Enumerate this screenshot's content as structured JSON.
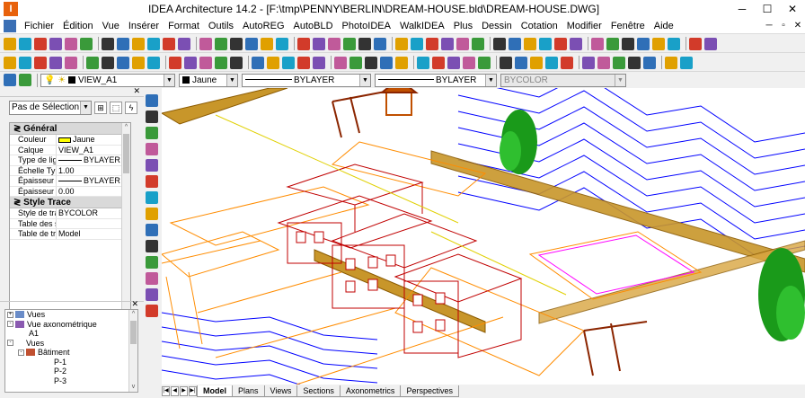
{
  "window": {
    "title": "IDEA Architecture 14.2  - [F:\\tmp\\PENNY\\BERLIN\\DREAM-HOUSE.bld\\DREAM-HOUSE.DWG]",
    "app_icon": "IDEA-app-icon",
    "controls": [
      "─",
      "☐",
      "✕"
    ]
  },
  "menu": [
    "Fichier",
    "Édition",
    "Vue",
    "Insérer",
    "Format",
    "Outils",
    "AutoREG",
    "AutoBLD",
    "PhotoIDEA",
    "WalkIDEA",
    "Plus",
    "Dessin",
    "Cotation",
    "Modifier",
    "Fenêtre",
    "Aide"
  ],
  "menu_right_controls": [
    "─",
    "▫",
    "✕"
  ],
  "layer_bar": {
    "layer": "VIEW_A1",
    "color": "Jaune",
    "linetype": "BYLAYER",
    "lineweight": "BYLAYER",
    "plotstyle": "BYCOLOR"
  },
  "properties": {
    "selection": "Pas de Sélection",
    "sections": [
      {
        "title": "Général",
        "rows": [
          {
            "name": "Couleur",
            "value": "Jaune"
          },
          {
            "name": "Calque",
            "value": "VIEW_A1"
          },
          {
            "name": "Type de ligne",
            "value": "BYLAYER"
          },
          {
            "name": "Échelle Typ...",
            "value": "1.00"
          },
          {
            "name": "Épaisseur ligne",
            "value": "BYLAYER"
          },
          {
            "name": "Épaisseur",
            "value": "0.00"
          }
        ]
      },
      {
        "title": "Style Trace",
        "rows": [
          {
            "name": "Style de trace",
            "value": "BYCOLOR"
          },
          {
            "name": "Table des st...",
            "value": ""
          },
          {
            "name": "Table de tra...",
            "value": "Model"
          }
        ]
      }
    ]
  },
  "tree": [
    {
      "label": "Vues",
      "level": 0,
      "toggle": "+",
      "icon": true
    },
    {
      "label": "Vue axonométrique",
      "level": 0,
      "toggle": "-",
      "icon": true
    },
    {
      "label": "A1",
      "level": 1,
      "toggle": "",
      "icon": false
    },
    {
      "label": "Vues",
      "level": 0,
      "toggle": "-",
      "icon": false
    },
    {
      "label": "Bâtiment",
      "level": 1,
      "toggle": "-",
      "icon": true
    },
    {
      "label": "P-1",
      "level": 2,
      "toggle": "",
      "icon": false
    },
    {
      "label": "P-2",
      "level": 2,
      "toggle": "",
      "icon": false
    },
    {
      "label": "P-3",
      "level": 2,
      "toggle": "",
      "icon": false
    }
  ],
  "tabs": [
    "Model",
    "Plans",
    "Views",
    "Sections",
    "Axonometrics",
    "Perspectives"
  ],
  "active_tab": "Model",
  "colors": {
    "contour": "#0000ff",
    "building": "#c00000",
    "terrace": "#ff8c00",
    "fence": "#b8860b",
    "pool": "#ff00ff",
    "tree": "#1a9a1a"
  }
}
